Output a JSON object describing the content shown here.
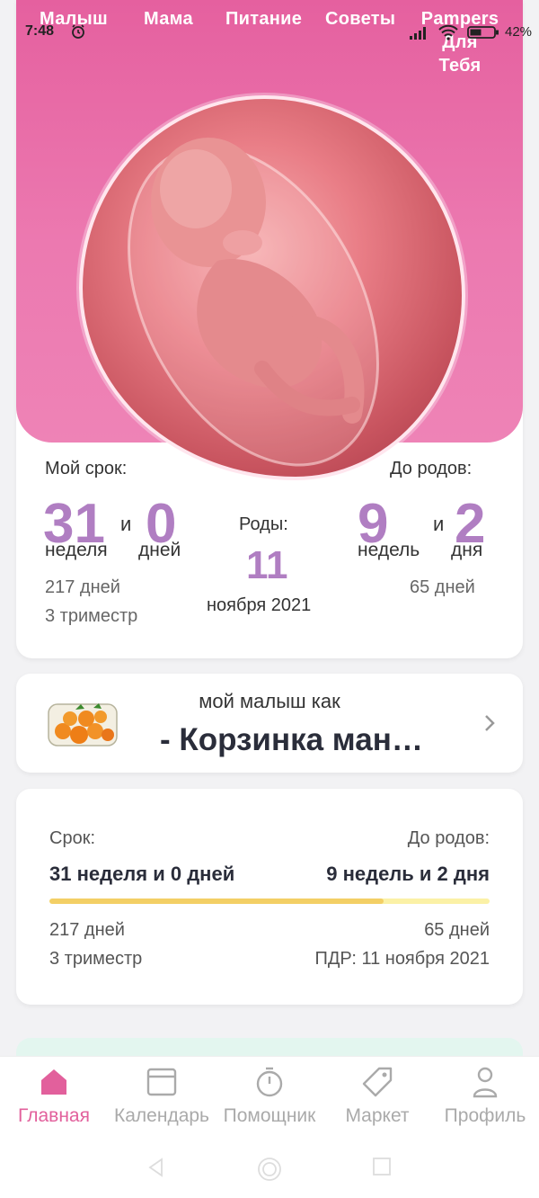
{
  "status_bar": {
    "time": "7:48",
    "battery": "42%"
  },
  "nav": {
    "tabs": [
      "Малыш",
      "Мама",
      "Питание",
      "Советы",
      "Pampers",
      "Для",
      "Тебя"
    ]
  },
  "stats": {
    "my_term_label": "Мой срок:",
    "until_birth_label": "До родов:",
    "weeks": "31",
    "and1": "и",
    "days": "0",
    "weeks_unit": "неделя",
    "days_unit": "дней",
    "birth_label": "Роды:",
    "birth_day": "11",
    "birth_month_year": "ноября 2021",
    "weeks_left": "9",
    "and2": "и",
    "days_left": "2",
    "weeks_left_unit": "недель",
    "days_left_unit": "дня",
    "days_total": "217 дней",
    "trimester": "3 триместр",
    "days_remaining": "65 дней"
  },
  "size_card": {
    "caption": "мой малыш как",
    "fruit": "- Корзинка ман…"
  },
  "term_card": {
    "term_label": "Срок:",
    "until_label": "До родов:",
    "term_value": "31 неделя и 0 дней",
    "until_value": "9 недель и 2 дня",
    "progress": 0.76,
    "days_total": "217 дней",
    "trimester": "3 триместр",
    "days_remaining": "65 дней",
    "due_date": "ПДР: 11 ноября 2021"
  },
  "tabbar": {
    "items": [
      {
        "label": "Главная",
        "icon": "home-icon"
      },
      {
        "label": "Календарь",
        "icon": "calendar-icon"
      },
      {
        "label": "Помощник",
        "icon": "timer-icon"
      },
      {
        "label": "Маркет",
        "icon": "tag-icon"
      },
      {
        "label": "Профиль",
        "icon": "profile-icon"
      }
    ]
  },
  "colors": {
    "accent": "#e2609c",
    "number": "#b07ec2",
    "progress": "#f3cf65",
    "progress_track": "#fbf1a6"
  }
}
